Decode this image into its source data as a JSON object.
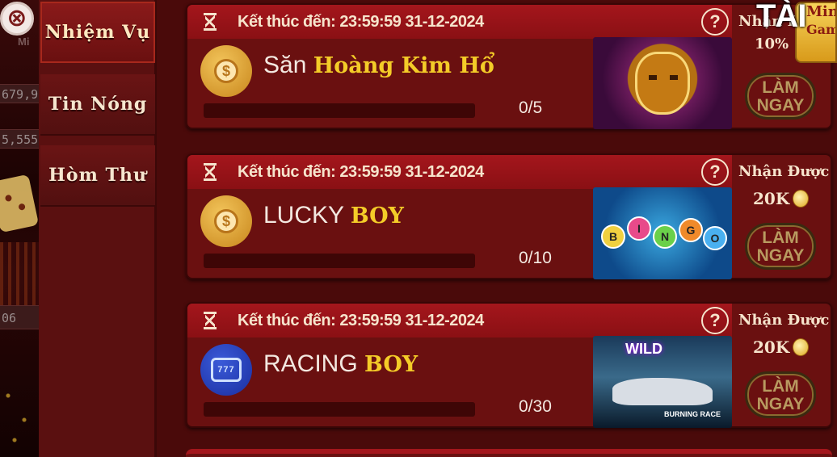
{
  "close_label": "⊗",
  "background": {
    "partial_text": "Mi",
    "numbers": [
      "679,9",
      "5,555",
      "06"
    ]
  },
  "sidebar": {
    "tabs": [
      {
        "label": "Nhiệm Vụ",
        "active": true
      },
      {
        "label": "Tin Nóng",
        "active": false
      },
      {
        "label": "Hòm Thư",
        "active": false
      }
    ]
  },
  "overlay": {
    "tai": "TÀI",
    "mini_line1": "Mini",
    "mini_line2": "Game",
    "pct": "10%"
  },
  "tasks": [
    {
      "deadline": "Kết thúc đến: 23:59:59 31-12-2024",
      "help": "?",
      "icon": "coin-stack-icon",
      "name_plain": "Săn ",
      "name_bold": "Hoàng Kim Hổ",
      "progress": "0/5",
      "progress_fraction": 0,
      "reward_title": "Nhận Được",
      "reward_amount": "",
      "button": "LÀM NGAY"
    },
    {
      "deadline": "Kết thúc đến: 23:59:59 31-12-2024",
      "help": "?",
      "icon": "coin-stack-icon",
      "name_plain": "LUCKY ",
      "name_bold": "BOY",
      "progress": "0/10",
      "progress_fraction": 0,
      "reward_title": "Nhận Được",
      "reward_amount": "20K",
      "button": "LÀM NGAY",
      "thumb_balls": [
        "B",
        "I",
        "N",
        "G",
        "O"
      ]
    },
    {
      "deadline": "Kết thúc đến: 23:59:59 31-12-2024",
      "help": "?",
      "icon": "slot-machine-icon",
      "slot_text": "777",
      "name_plain": "RACING ",
      "name_bold": "BOY",
      "progress": "0/30",
      "progress_fraction": 0,
      "reward_title": "Nhận Được",
      "reward_amount": "20K",
      "button": "LÀM NGAY",
      "thumb_wild": "WILD",
      "thumb_label": "BURNING RACE"
    }
  ],
  "colors": {
    "accent_gold": "#f4cc28",
    "header_red": "#a4161c",
    "card_bg": "#6a1010"
  }
}
